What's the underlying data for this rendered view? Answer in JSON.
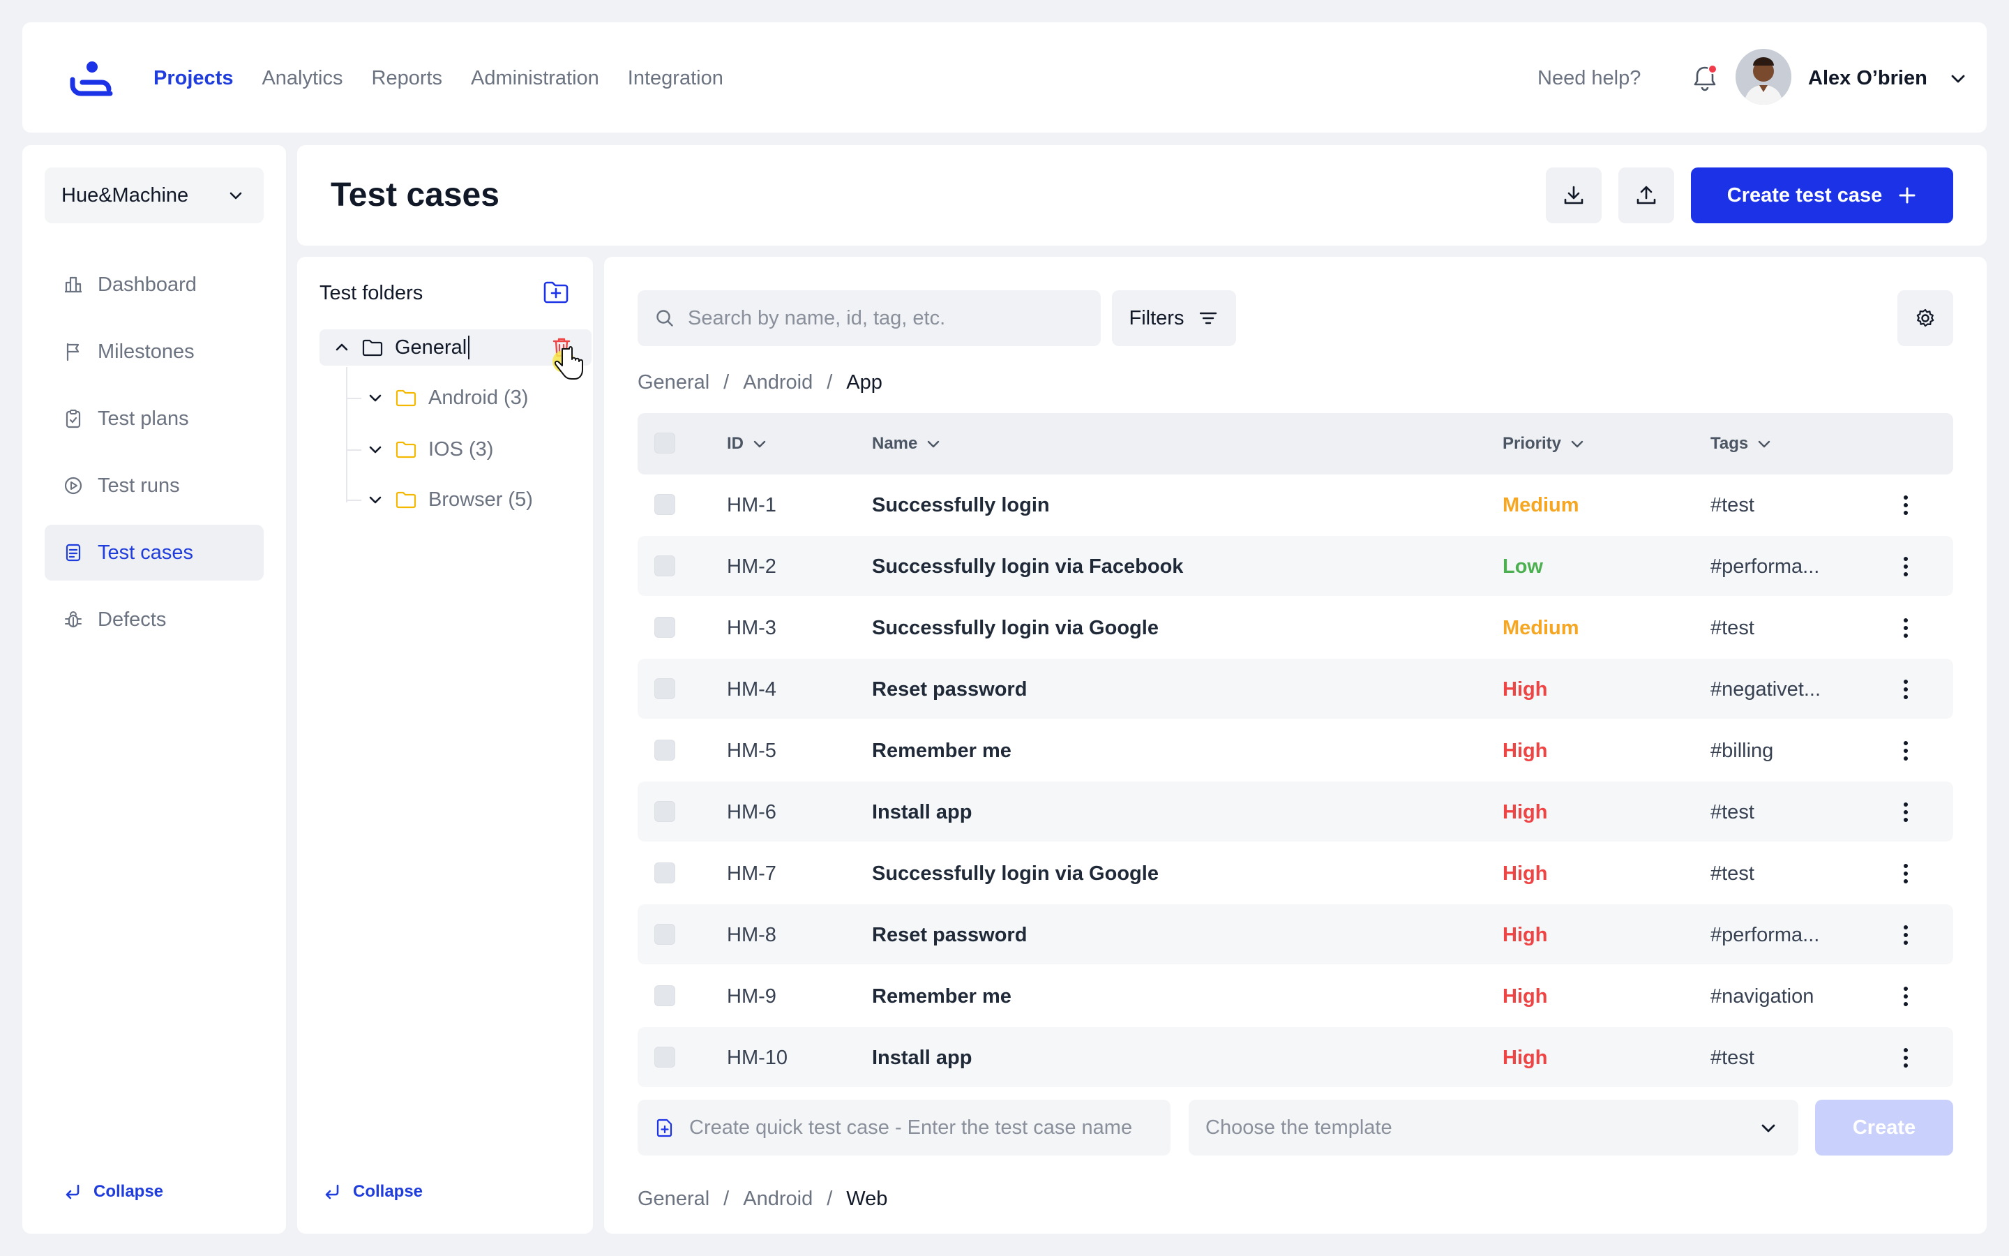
{
  "nav": {
    "items": [
      {
        "label": "Projects",
        "active": true
      },
      {
        "label": "Analytics",
        "active": false
      },
      {
        "label": "Reports",
        "active": false
      },
      {
        "label": "Administration",
        "active": false
      },
      {
        "label": "Integration",
        "active": false
      }
    ],
    "help": "Need help?",
    "user_name": "Alex O’brien",
    "notification_dot": true
  },
  "sidebar": {
    "project": "Hue&Machine",
    "items": [
      {
        "label": "Dashboard",
        "icon": "dashboard-icon"
      },
      {
        "label": "Milestones",
        "icon": "flag-icon"
      },
      {
        "label": "Test plans",
        "icon": "clipboard-icon"
      },
      {
        "label": "Test runs",
        "icon": "play-circle-icon"
      },
      {
        "label": "Test cases",
        "icon": "document-icon",
        "active": true
      },
      {
        "label": "Defects",
        "icon": "bug-icon"
      }
    ],
    "collapse": "Collapse"
  },
  "header": {
    "title": "Test cases",
    "create_label": "Create test case"
  },
  "folders": {
    "title": "Test folders",
    "root": "General",
    "children": [
      "Android (3)",
      "IOS (3)",
      "Browser (5)"
    ],
    "collapse": "Collapse"
  },
  "main": {
    "search_placeholder": "Search by name, id, tag, etc.",
    "filters_label": "Filters",
    "breadcrumb": [
      "General",
      "Android",
      "App"
    ],
    "columns": {
      "id": "ID",
      "name": "Name",
      "priority": "Priority",
      "tags": "Tags"
    },
    "rows": [
      {
        "id": "HM-1",
        "name": "Successfully login",
        "priority": "Medium",
        "tag": "#test"
      },
      {
        "id": "HM-2",
        "name": "Successfully login via Facebook",
        "priority": "Low",
        "tag": "#performa..."
      },
      {
        "id": "HM-3",
        "name": "Successfully login via Google",
        "priority": "Medium",
        "tag": "#test"
      },
      {
        "id": "HM-4",
        "name": "Reset password",
        "priority": "High",
        "tag": "#negativet..."
      },
      {
        "id": "HM-5",
        "name": "Remember me",
        "priority": "High",
        "tag": "#billing"
      },
      {
        "id": "HM-6",
        "name": "Install app",
        "priority": "High",
        "tag": "#test"
      },
      {
        "id": "HM-7",
        "name": "Successfully login via Google",
        "priority": "High",
        "tag": "#test"
      },
      {
        "id": "HM-8",
        "name": "Reset password",
        "priority": "High",
        "tag": "#performa..."
      },
      {
        "id": "HM-9",
        "name": "Remember me",
        "priority": "High",
        "tag": "#navigation"
      },
      {
        "id": "HM-10",
        "name": "Install app",
        "priority": "High",
        "tag": "#test"
      }
    ],
    "quick_placeholder": "Create quick test case - Enter the test case name",
    "template_placeholder": "Choose the template",
    "create_label": "Create",
    "breadcrumb2": [
      "General",
      "Android",
      "Web"
    ]
  },
  "colors": {
    "accent": "#1b32e6",
    "priority": {
      "Medium": "#f5a623",
      "Low": "#4caf50",
      "High": "#ef4444"
    }
  }
}
